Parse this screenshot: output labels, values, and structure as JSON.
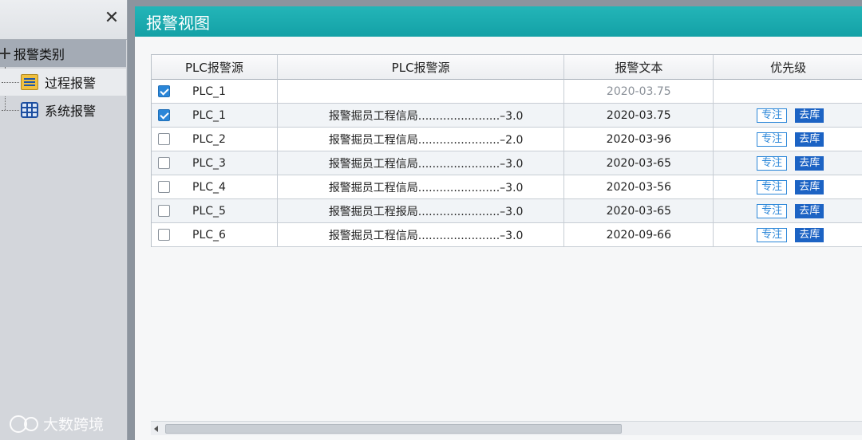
{
  "sidebar": {
    "close_symbol": "✕",
    "root_label": "报警类别",
    "items": [
      {
        "label": "过程报警",
        "icon": "document-list-icon"
      },
      {
        "label": "系统报警",
        "icon": "grid-table-icon"
      }
    ]
  },
  "main": {
    "title": "报警视图",
    "columns": [
      "PLC报警源",
      "PLC报警源",
      "报警文本",
      "优先级"
    ],
    "rows": [
      {
        "checked": true,
        "source": "PLC_1",
        "text": "",
        "date": "2020-03.75",
        "buttons": false
      },
      {
        "checked": true,
        "source": "PLC_1",
        "text": "报警掘员工程信局.......................–3.0",
        "date": "2020-03.75",
        "buttons": true
      },
      {
        "checked": false,
        "source": "PLC_2",
        "text": "报警掘员工程信局.......................–2.0",
        "date": "2020-03-96",
        "buttons": true
      },
      {
        "checked": false,
        "source": "PLC_3",
        "text": "报警掘员工程信局.......................–3.0",
        "date": "2020-03-65",
        "buttons": true
      },
      {
        "checked": false,
        "source": "PLC_4",
        "text": "报警掘员工程信局.......................–3.0",
        "date": "2020-03-56",
        "buttons": true
      },
      {
        "checked": false,
        "source": "PLC_5",
        "text": "报警掘员工程报局.......................–3.0",
        "date": "2020-03-65",
        "buttons": true
      },
      {
        "checked": false,
        "source": "PLC_6",
        "text": "报警掘员工程信局.......................–3.0",
        "date": "2020-09-66",
        "buttons": true
      }
    ],
    "btn_focus": "专注",
    "btn_go": "去库"
  },
  "watermark": {
    "text": "大数跨境"
  },
  "colors": {
    "title_bar": "#1aabb0",
    "accent": "#2a86d8",
    "solid_button": "#1c63c4"
  }
}
